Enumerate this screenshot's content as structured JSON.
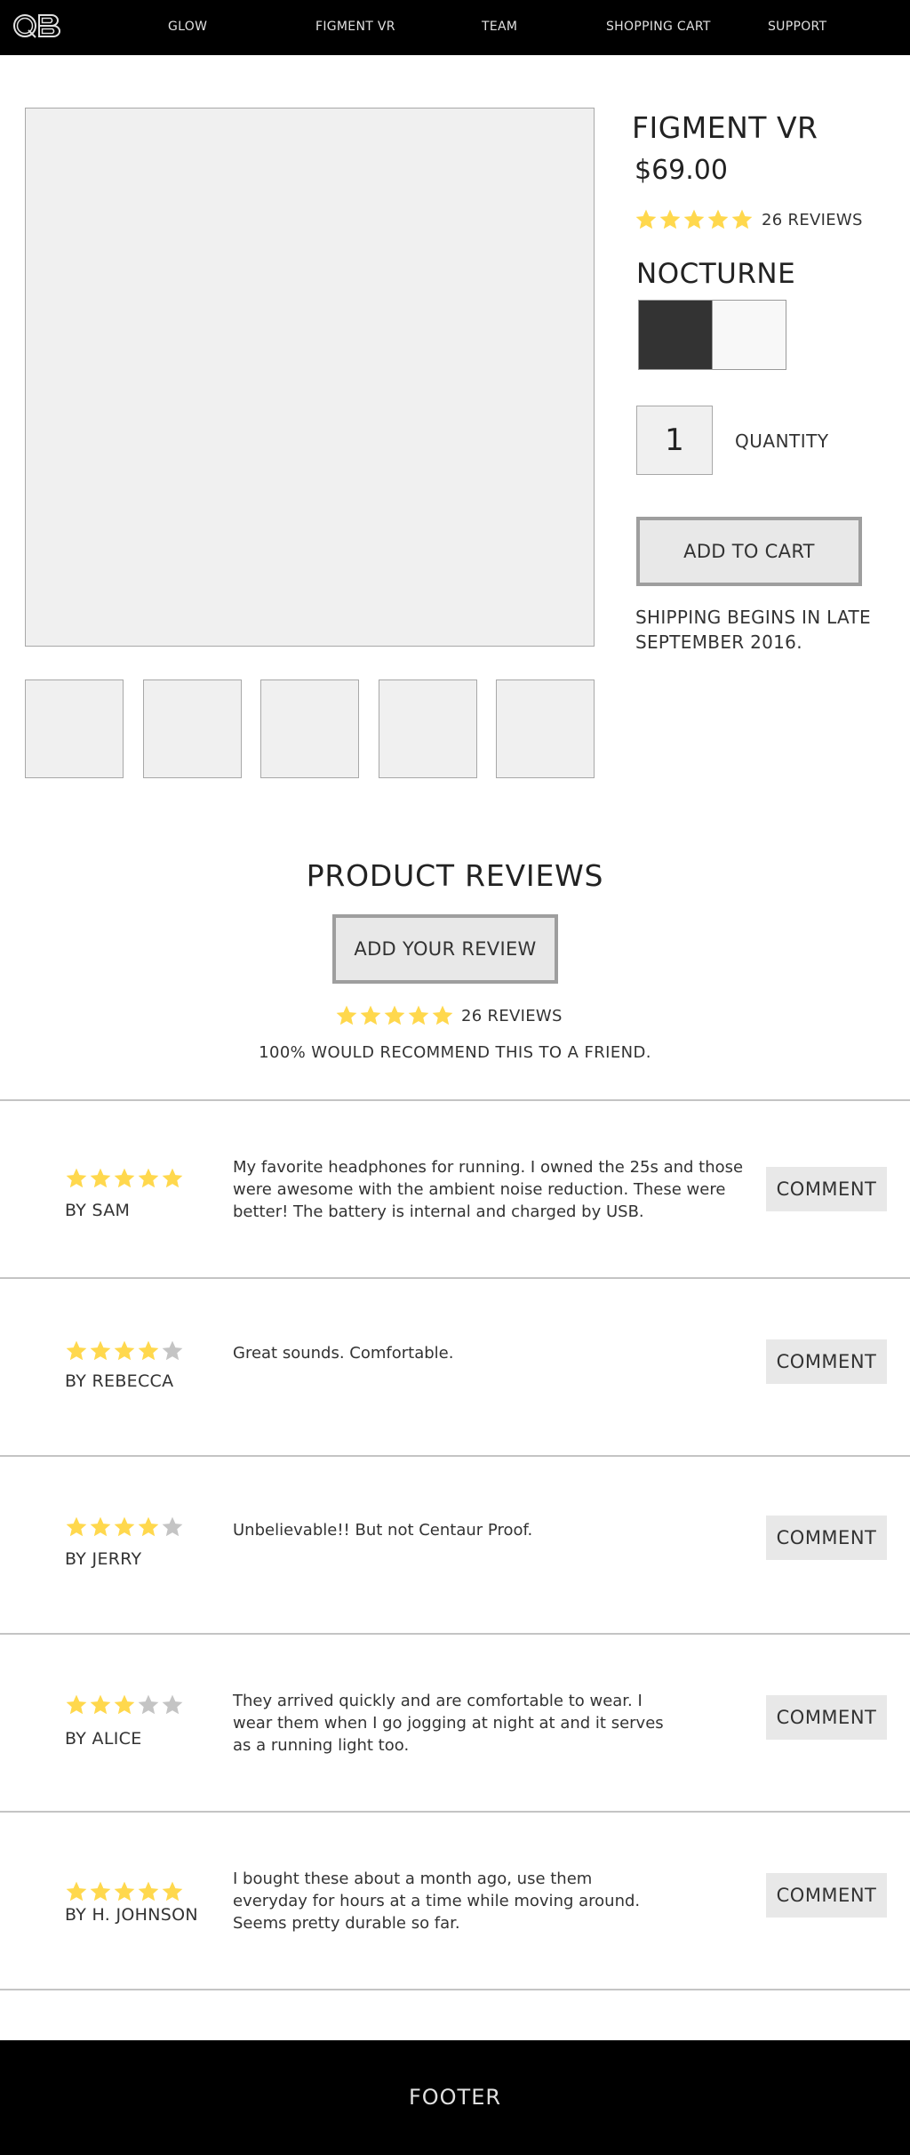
{
  "nav": {
    "logo_text": "QB",
    "items": [
      {
        "label": "GLOW"
      },
      {
        "label": "FIGMENT VR"
      },
      {
        "label": "TEAM"
      },
      {
        "label": "SHOPPING CART"
      },
      {
        "label": "SUPPORT"
      }
    ]
  },
  "product": {
    "title": "FIGMENT VR",
    "price": "$69.00",
    "rating": 5,
    "reviews_label": "26 REVIEWS",
    "color_name": "NOCTURNE",
    "swatches": [
      {
        "color": "#333333"
      },
      {
        "color": "#f8f8f8"
      }
    ],
    "quantity": "1",
    "quantity_label": "QUANTITY",
    "add_to_cart_label": "ADD TO CART",
    "shipping_note": "SHIPPING BEGINS IN LATE SEPTEMBER 2016."
  },
  "reviews": {
    "title": "PRODUCT REVIEWS",
    "add_review_label": "ADD YOUR REVIEW",
    "rating": 5,
    "count_label": "26 REVIEWS",
    "recommend_text": "100% WOULD RECOMMEND THIS TO A FRIEND.",
    "comment_label": "COMMENT",
    "items": [
      {
        "rating": 5,
        "author": "BY SAM",
        "lines": [
          "My favorite headphones for running. I owned the 25s and those",
          "were awesome with the ambient noise reduction. These were",
          "better! The battery is internal and charged by USB."
        ]
      },
      {
        "rating": 4,
        "author": "BY REBECCA",
        "lines": [
          "Great sounds. Comfortable."
        ]
      },
      {
        "rating": 4,
        "author": "BY JERRY",
        "lines": [
          "Unbelievable!! But not Centaur Proof."
        ]
      },
      {
        "rating": 3,
        "author": "BY ALICE",
        "lines": [
          "They arrived quickly and are comfortable to wear. I",
          "wear them when I go jogging at night at and it serves",
          "as a running light too."
        ]
      },
      {
        "rating": 5,
        "author": "BY H. JOHNSON",
        "lines": [
          "I bought these about a month ago, use them",
          "everyday for hours at a time while moving around.",
          "Seems pretty durable so far."
        ]
      }
    ]
  },
  "footer": {
    "label": "FOOTER"
  },
  "colors": {
    "star_filled": "#FFD84D",
    "star_empty": "#C4C4C4",
    "nav_bg": "#000000"
  }
}
